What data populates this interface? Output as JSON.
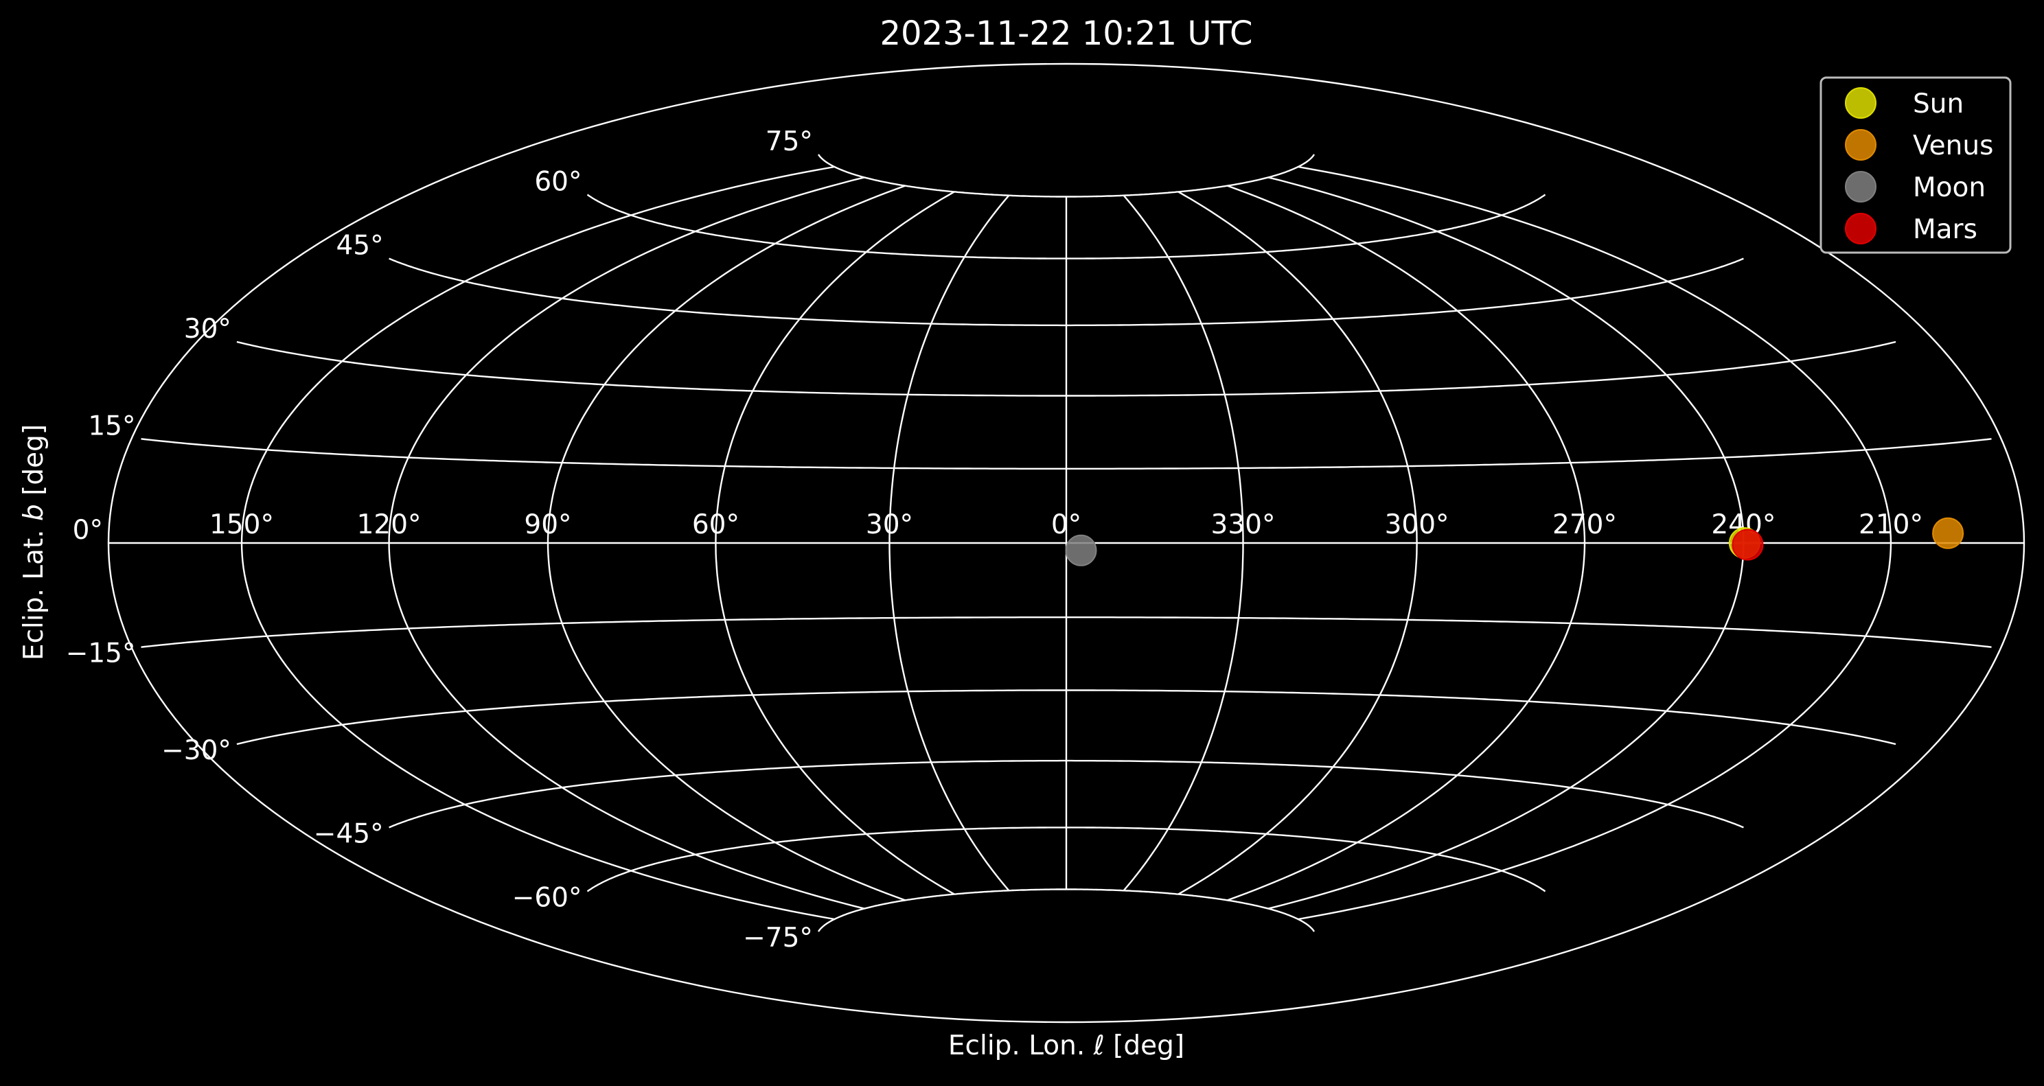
{
  "colors": {
    "background": "#000000",
    "grid": "#ffffff",
    "text": "#ffffff",
    "legend_border": "#bbbbbb"
  },
  "chart_data": {
    "type": "scatter",
    "projection": "hammer",
    "title": "2023-11-22 10:21 UTC",
    "xlabel": "Eclip. Lon. ℓ [deg]",
    "ylabel_prefix": "Eclip. Lat. ",
    "ylabel_var": "b",
    "ylabel_suffix": " [deg]",
    "x_direction": "increasing-left",
    "grid": true,
    "legend_position": "top-right",
    "lon_ticks": [
      {
        "value": 150,
        "label": "150°"
      },
      {
        "value": 120,
        "label": "120°"
      },
      {
        "value": 90,
        "label": "90°"
      },
      {
        "value": 60,
        "label": "60°"
      },
      {
        "value": 30,
        "label": "30°"
      },
      {
        "value": 0,
        "label": "0°"
      },
      {
        "value": 330,
        "label": "330°"
      },
      {
        "value": 300,
        "label": "300°"
      },
      {
        "value": 270,
        "label": "270°"
      },
      {
        "value": 240,
        "label": "240°"
      },
      {
        "value": 210,
        "label": "210°"
      }
    ],
    "lat_ticks": [
      {
        "value": 75,
        "label": "75°"
      },
      {
        "value": 60,
        "label": "60°"
      },
      {
        "value": 45,
        "label": "45°"
      },
      {
        "value": 30,
        "label": "30°"
      },
      {
        "value": 15,
        "label": "15°"
      },
      {
        "value": 0,
        "label": "0°"
      },
      {
        "value": -15,
        "label": "−15°"
      },
      {
        "value": -30,
        "label": "−30°"
      },
      {
        "value": -45,
        "label": "−45°"
      },
      {
        "value": -60,
        "label": "−60°"
      },
      {
        "value": -75,
        "label": "−75°"
      }
    ],
    "series": [
      {
        "name": "Sun",
        "color": "#dddd00",
        "points": [
          {
            "lon": 239.8,
            "lat": 0.0
          }
        ]
      },
      {
        "name": "Venus",
        "color": "#e08a00",
        "points": [
          {
            "lon": 197.5,
            "lat": 1.5
          }
        ]
      },
      {
        "name": "Moon",
        "color": "#808080",
        "points": [
          {
            "lon": 357.5,
            "lat": -1.5
          }
        ]
      },
      {
        "name": "Mars",
        "color": "#e00000",
        "points": [
          {
            "lon": 239.2,
            "lat": -0.3
          }
        ]
      }
    ]
  }
}
